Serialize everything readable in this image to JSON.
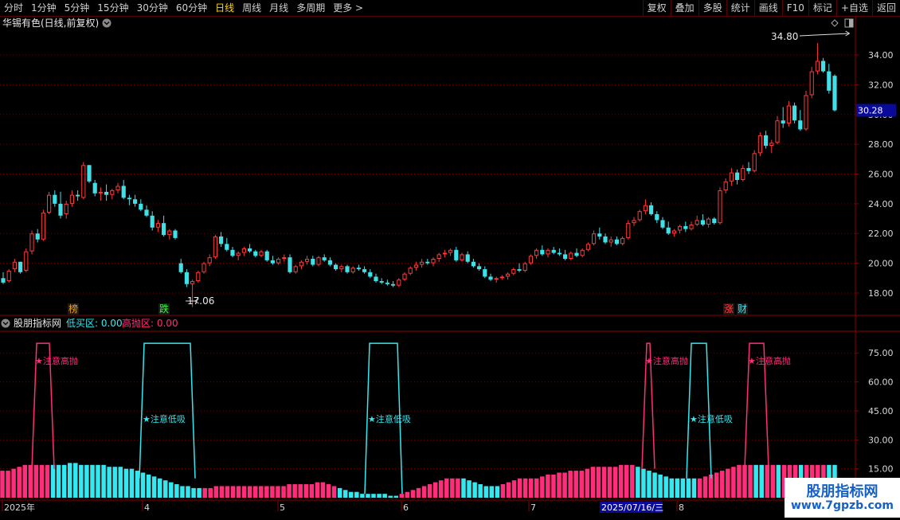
{
  "toolbar": {
    "periods": [
      "分时",
      "1分钟",
      "5分钟",
      "15分钟",
      "30分钟",
      "60分钟",
      "日线",
      "周线",
      "月线",
      "多周期",
      "更多 >"
    ],
    "active_period": "日线",
    "actions": [
      "复权",
      "叠加",
      "多股",
      "统计",
      "画线",
      "F10",
      "标记",
      "+自选",
      "返回"
    ]
  },
  "main_chart": {
    "title": "华锡有色(日线,前复权)",
    "high_label": "34.80",
    "low_label": "17.06",
    "current_price": "30.28",
    "y_ticks": [
      "34.00",
      "32.00",
      "30.00",
      "28.00",
      "26.00",
      "24.00",
      "22.00",
      "20.00",
      "18.00"
    ],
    "markers": [
      "榜",
      "跌",
      "涨",
      "财"
    ]
  },
  "indicator": {
    "name": "股朋指标网",
    "low_label": "低买区: 0.00",
    "high_label": "高抛区: 0.00",
    "y_ticks": [
      "75.00",
      "60.00",
      "45.00",
      "30.00",
      "15.00"
    ],
    "annotations": [
      "★注意高抛",
      "★注意低吸",
      "★注意低吸",
      "★注意高抛",
      "★注意低吸",
      "★注意高抛"
    ]
  },
  "time_axis": {
    "labels": [
      "2025年",
      "4",
      "5",
      "6",
      "7",
      "2025/07/16/三",
      "8"
    ]
  },
  "watermark": {
    "site_name": "股朋指标网",
    "url": "www.7gpzb.com"
  },
  "colors": {
    "up": "#ff3a3a",
    "down": "#3fe0e8",
    "pink": "#ff2d7a",
    "cyan": "#33e8f0",
    "grid": "#6b0000",
    "axis_text": "#d8d8d8"
  },
  "chart_data": {
    "type": "candlestick",
    "y_range": [
      16.5,
      35.5
    ],
    "candles": [
      [
        19.0,
        19.4,
        18.6,
        18.7
      ],
      [
        18.8,
        19.6,
        18.7,
        19.5
      ],
      [
        19.6,
        20.3,
        19.4,
        20.1
      ],
      [
        20.1,
        20.1,
        19.3,
        19.4
      ],
      [
        19.5,
        21.0,
        19.4,
        20.8
      ],
      [
        20.8,
        22.2,
        20.6,
        22.0
      ],
      [
        22.0,
        22.3,
        21.4,
        21.6
      ],
      [
        21.6,
        23.6,
        21.5,
        23.4
      ],
      [
        23.4,
        24.8,
        23.3,
        24.6
      ],
      [
        24.6,
        24.9,
        23.8,
        24.0
      ],
      [
        24.0,
        24.8,
        23.0,
        23.2
      ],
      [
        23.3,
        24.2,
        23.0,
        24.0
      ],
      [
        24.0,
        24.9,
        23.8,
        24.6
      ],
      [
        24.6,
        24.9,
        24.2,
        24.5
      ],
      [
        24.4,
        26.8,
        24.3,
        26.6
      ],
      [
        26.6,
        26.6,
        25.4,
        25.5
      ],
      [
        25.4,
        25.6,
        24.5,
        24.7
      ],
      [
        24.7,
        25.1,
        24.2,
        24.8
      ],
      [
        24.8,
        25.3,
        24.2,
        24.6
      ],
      [
        24.6,
        25.0,
        24.3,
        24.9
      ],
      [
        24.9,
        25.4,
        24.7,
        25.2
      ],
      [
        25.2,
        25.6,
        24.3,
        24.4
      ],
      [
        24.4,
        24.6,
        23.9,
        24.3
      ],
      [
        24.3,
        24.6,
        23.8,
        24.0
      ],
      [
        24.0,
        24.3,
        23.5,
        23.6
      ],
      [
        23.6,
        23.9,
        23.1,
        23.2
      ],
      [
        23.2,
        23.5,
        22.2,
        22.4
      ],
      [
        22.4,
        22.9,
        22.1,
        22.7
      ],
      [
        22.7,
        23.2,
        21.8,
        21.9
      ],
      [
        21.9,
        22.3,
        21.6,
        22.2
      ],
      [
        22.2,
        22.3,
        21.6,
        21.7
      ],
      [
        20.0,
        20.3,
        19.3,
        19.4
      ],
      [
        19.4,
        19.6,
        18.4,
        18.6
      ],
      [
        18.6,
        18.9,
        17.06,
        18.8
      ],
      [
        18.8,
        19.5,
        18.7,
        19.4
      ],
      [
        19.4,
        20.1,
        19.3,
        20.0
      ],
      [
        20.0,
        20.6,
        19.8,
        20.4
      ],
      [
        20.4,
        21.9,
        20.3,
        21.8
      ],
      [
        21.8,
        22.1,
        21.1,
        21.3
      ],
      [
        21.3,
        21.7,
        20.8,
        20.9
      ],
      [
        20.9,
        21.1,
        20.4,
        20.5
      ],
      [
        20.5,
        20.8,
        20.2,
        20.7
      ],
      [
        20.7,
        21.1,
        20.5,
        21.0
      ],
      [
        21.0,
        21.3,
        20.7,
        20.8
      ],
      [
        20.8,
        20.9,
        20.4,
        20.5
      ],
      [
        20.5,
        20.9,
        20.4,
        20.8
      ],
      [
        20.8,
        20.9,
        20.1,
        20.2
      ],
      [
        20.2,
        20.5,
        19.9,
        20.0
      ],
      [
        20.0,
        20.4,
        19.9,
        20.3
      ],
      [
        20.3,
        20.6,
        20.1,
        20.4
      ],
      [
        20.4,
        20.6,
        19.3,
        19.4
      ],
      [
        19.4,
        19.9,
        19.3,
        19.8
      ],
      [
        19.8,
        20.2,
        19.6,
        20.1
      ],
      [
        20.1,
        20.5,
        19.9,
        20.3
      ],
      [
        20.3,
        20.5,
        19.8,
        19.9
      ],
      [
        19.9,
        20.5,
        19.8,
        20.4
      ],
      [
        20.4,
        20.6,
        20.1,
        20.2
      ],
      [
        20.2,
        20.4,
        19.8,
        19.9
      ],
      [
        19.9,
        20.0,
        19.5,
        19.6
      ],
      [
        19.6,
        19.9,
        19.4,
        19.8
      ],
      [
        19.8,
        19.9,
        19.3,
        19.4
      ],
      [
        19.4,
        19.8,
        19.3,
        19.7
      ],
      [
        19.7,
        19.9,
        19.5,
        19.6
      ],
      [
        19.6,
        19.8,
        19.3,
        19.4
      ],
      [
        19.4,
        19.6,
        19.0,
        19.1
      ],
      [
        19.1,
        19.3,
        18.7,
        18.8
      ],
      [
        18.8,
        19.0,
        18.6,
        18.7
      ],
      [
        18.7,
        18.9,
        18.5,
        18.6
      ],
      [
        18.6,
        18.8,
        18.4,
        18.5
      ],
      [
        18.5,
        19.0,
        18.4,
        18.9
      ],
      [
        18.9,
        19.4,
        18.8,
        19.3
      ],
      [
        19.3,
        19.8,
        19.2,
        19.7
      ],
      [
        19.7,
        20.1,
        19.5,
        19.9
      ],
      [
        19.9,
        20.3,
        19.7,
        20.1
      ],
      [
        20.1,
        20.3,
        19.9,
        20.0
      ],
      [
        20.0,
        20.4,
        19.8,
        20.3
      ],
      [
        20.3,
        20.7,
        20.1,
        20.6
      ],
      [
        20.6,
        20.9,
        20.4,
        20.7
      ],
      [
        20.7,
        21.0,
        20.5,
        20.9
      ],
      [
        20.9,
        21.1,
        20.1,
        20.2
      ],
      [
        20.2,
        20.7,
        20.1,
        20.6
      ],
      [
        20.6,
        20.8,
        20.0,
        20.1
      ],
      [
        20.1,
        20.3,
        19.7,
        19.8
      ],
      [
        19.8,
        20.0,
        19.5,
        19.6
      ],
      [
        19.6,
        19.8,
        19.0,
        19.1
      ],
      [
        19.1,
        19.3,
        18.8,
        18.9
      ],
      [
        18.9,
        19.1,
        18.7,
        19.0
      ],
      [
        19.0,
        19.2,
        18.9,
        19.1
      ],
      [
        19.1,
        19.4,
        18.9,
        19.3
      ],
      [
        19.3,
        19.7,
        19.2,
        19.6
      ],
      [
        19.6,
        20.0,
        19.4,
        19.5
      ],
      [
        19.5,
        20.1,
        19.4,
        20.0
      ],
      [
        20.0,
        20.6,
        19.9,
        20.5
      ],
      [
        20.5,
        21.0,
        20.3,
        20.9
      ],
      [
        20.9,
        21.2,
        20.5,
        20.6
      ],
      [
        20.6,
        21.0,
        20.4,
        20.9
      ],
      [
        20.9,
        21.1,
        20.6,
        20.7
      ],
      [
        20.7,
        21.0,
        20.5,
        20.6
      ],
      [
        20.6,
        20.9,
        20.2,
        20.3
      ],
      [
        20.3,
        20.8,
        20.2,
        20.7
      ],
      [
        20.7,
        21.0,
        20.4,
        20.5
      ],
      [
        20.5,
        21.0,
        20.4,
        20.9
      ],
      [
        20.9,
        21.4,
        20.8,
        21.3
      ],
      [
        21.3,
        22.2,
        21.2,
        22.0
      ],
      [
        22.0,
        22.4,
        21.6,
        21.8
      ],
      [
        21.8,
        22.0,
        21.3,
        21.4
      ],
      [
        21.4,
        21.8,
        21.1,
        21.6
      ],
      [
        21.6,
        21.8,
        21.2,
        21.3
      ],
      [
        21.3,
        21.8,
        21.2,
        21.7
      ],
      [
        21.7,
        22.9,
        21.6,
        22.7
      ],
      [
        22.7,
        23.1,
        22.5,
        22.9
      ],
      [
        22.9,
        23.6,
        22.8,
        23.5
      ],
      [
        23.5,
        24.3,
        23.3,
        23.9
      ],
      [
        23.9,
        24.1,
        23.2,
        23.3
      ],
      [
        23.3,
        23.5,
        22.7,
        22.9
      ],
      [
        22.9,
        23.1,
        22.3,
        22.4
      ],
      [
        22.4,
        22.8,
        21.9,
        22.0
      ],
      [
        22.0,
        22.3,
        21.8,
        22.2
      ],
      [
        22.2,
        22.6,
        22.0,
        22.5
      ],
      [
        22.5,
        22.8,
        22.1,
        22.3
      ],
      [
        22.3,
        22.8,
        22.2,
        22.6
      ],
      [
        22.6,
        23.2,
        22.5,
        22.9
      ],
      [
        22.9,
        23.3,
        22.5,
        22.6
      ],
      [
        22.6,
        23.1,
        22.4,
        23.0
      ],
      [
        23.0,
        23.1,
        22.6,
        22.7
      ],
      [
        22.7,
        25.1,
        22.6,
        24.9
      ],
      [
        24.9,
        25.7,
        24.7,
        25.5
      ],
      [
        25.5,
        26.4,
        25.2,
        26.1
      ],
      [
        26.1,
        26.3,
        25.3,
        25.6
      ],
      [
        25.6,
        26.6,
        25.5,
        26.4
      ],
      [
        26.4,
        26.8,
        26.0,
        26.2
      ],
      [
        26.2,
        27.6,
        26.1,
        27.4
      ],
      [
        27.4,
        28.8,
        27.2,
        28.6
      ],
      [
        28.6,
        28.9,
        27.7,
        27.9
      ],
      [
        27.9,
        28.3,
        27.4,
        28.1
      ],
      [
        28.1,
        29.9,
        28.0,
        29.6
      ],
      [
        29.6,
        30.5,
        29.1,
        29.4
      ],
      [
        29.4,
        30.9,
        29.2,
        30.6
      ],
      [
        30.6,
        30.8,
        29.4,
        29.6
      ],
      [
        29.6,
        30.3,
        28.9,
        29.0
      ],
      [
        29.0,
        31.6,
        28.9,
        31.3
      ],
      [
        31.3,
        33.2,
        31.1,
        32.9
      ],
      [
        32.9,
        34.8,
        32.7,
        33.6
      ],
      [
        33.6,
        33.8,
        32.8,
        32.9
      ],
      [
        32.9,
        33.4,
        31.4,
        31.6
      ],
      [
        32.6,
        32.7,
        30.2,
        30.28
      ]
    ],
    "indicator_bars": [
      [
        14,
        1
      ],
      [
        14,
        1
      ],
      [
        15,
        1
      ],
      [
        16,
        1
      ],
      [
        17,
        1
      ],
      [
        17,
        1
      ],
      [
        17,
        1
      ],
      [
        17,
        1
      ],
      [
        17,
        1
      ],
      [
        17,
        0
      ],
      [
        17,
        0
      ],
      [
        17,
        0
      ],
      [
        18,
        0
      ],
      [
        18,
        0
      ],
      [
        17,
        0
      ],
      [
        17,
        0
      ],
      [
        17,
        0
      ],
      [
        17,
        0
      ],
      [
        17,
        0
      ],
      [
        16,
        0
      ],
      [
        16,
        0
      ],
      [
        16,
        0
      ],
      [
        15,
        0
      ],
      [
        15,
        0
      ],
      [
        14,
        0
      ],
      [
        13,
        0
      ],
      [
        12,
        0
      ],
      [
        11,
        0
      ],
      [
        10,
        0
      ],
      [
        9,
        0
      ],
      [
        8,
        0
      ],
      [
        7,
        0
      ],
      [
        6,
        0
      ],
      [
        6,
        0
      ],
      [
        5,
        0
      ],
      [
        5,
        0
      ],
      [
        5,
        1
      ],
      [
        5,
        1
      ],
      [
        6,
        1
      ],
      [
        6,
        1
      ],
      [
        6,
        1
      ],
      [
        6,
        1
      ],
      [
        6,
        1
      ],
      [
        6,
        1
      ],
      [
        6,
        1
      ],
      [
        6,
        1
      ],
      [
        6,
        1
      ],
      [
        6,
        1
      ],
      [
        6,
        1
      ],
      [
        6,
        1
      ],
      [
        6,
        1
      ],
      [
        7,
        1
      ],
      [
        7,
        1
      ],
      [
        7,
        1
      ],
      [
        7,
        1
      ],
      [
        7,
        1
      ],
      [
        8,
        1
      ],
      [
        8,
        1
      ],
      [
        7,
        1
      ],
      [
        6,
        1
      ],
      [
        5,
        0
      ],
      [
        4,
        0
      ],
      [
        3,
        0
      ],
      [
        3,
        0
      ],
      [
        2,
        0
      ],
      [
        2,
        0
      ],
      [
        2,
        0
      ],
      [
        2,
        0
      ],
      [
        2,
        0
      ],
      [
        1,
        0
      ],
      [
        1,
        0
      ],
      [
        2,
        1
      ],
      [
        3,
        1
      ],
      [
        4,
        1
      ],
      [
        5,
        1
      ],
      [
        6,
        1
      ],
      [
        7,
        1
      ],
      [
        8,
        1
      ],
      [
        9,
        1
      ],
      [
        10,
        1
      ],
      [
        10,
        1
      ],
      [
        10,
        1
      ],
      [
        10,
        0
      ],
      [
        9,
        0
      ],
      [
        8,
        0
      ],
      [
        7,
        0
      ],
      [
        6,
        0
      ],
      [
        6,
        0
      ],
      [
        6,
        0
      ],
      [
        7,
        1
      ],
      [
        8,
        1
      ],
      [
        9,
        1
      ],
      [
        10,
        1
      ],
      [
        10,
        1
      ],
      [
        10,
        1
      ],
      [
        10,
        1
      ],
      [
        11,
        1
      ],
      [
        12,
        1
      ],
      [
        12,
        1
      ],
      [
        13,
        1
      ],
      [
        13,
        1
      ],
      [
        14,
        1
      ],
      [
        14,
        1
      ],
      [
        14,
        1
      ],
      [
        15,
        1
      ],
      [
        16,
        1
      ],
      [
        16,
        1
      ],
      [
        16,
        1
      ],
      [
        16,
        1
      ],
      [
        16,
        1
      ],
      [
        17,
        1
      ],
      [
        17,
        1
      ],
      [
        17,
        1
      ],
      [
        16,
        0
      ],
      [
        15,
        0
      ],
      [
        14,
        0
      ],
      [
        13,
        0
      ],
      [
        12,
        0
      ],
      [
        11,
        0
      ],
      [
        10,
        0
      ],
      [
        10,
        0
      ],
      [
        10,
        0
      ],
      [
        10,
        0
      ],
      [
        10,
        0
      ],
      [
        10,
        1
      ],
      [
        11,
        1
      ],
      [
        12,
        1
      ],
      [
        13,
        1
      ],
      [
        14,
        1
      ],
      [
        15,
        1
      ],
      [
        16,
        1
      ],
      [
        17,
        1
      ],
      [
        17,
        1
      ],
      [
        17,
        1
      ],
      [
        17,
        0
      ],
      [
        17,
        0
      ],
      [
        17,
        1
      ],
      [
        17,
        1
      ],
      [
        17,
        0
      ],
      [
        17,
        1
      ],
      [
        17,
        1
      ],
      [
        17,
        1
      ],
      [
        17,
        0
      ],
      [
        17,
        1
      ],
      [
        17,
        1
      ],
      [
        17,
        1
      ],
      [
        17,
        1
      ],
      [
        17,
        0
      ],
      [
        17,
        0
      ]
    ],
    "zones": [
      {
        "type": "high",
        "color": "pink",
        "x1": 40,
        "x2": 68,
        "top": 80,
        "base": 15
      },
      {
        "type": "low",
        "color": "cyan",
        "x1": 175,
        "x2": 245,
        "top": 80,
        "base": 10
      },
      {
        "type": "low",
        "color": "cyan",
        "x1": 458,
        "x2": 505,
        "top": 80,
        "base": 2
      },
      {
        "type": "high",
        "color": "pink",
        "x1": 806,
        "x2": 822,
        "top": 80,
        "base": 15
      },
      {
        "type": "low",
        "color": "cyan",
        "x1": 862,
        "x2": 893,
        "top": 80,
        "base": 10
      },
      {
        "type": "high",
        "color": "pink",
        "x1": 935,
        "x2": 965,
        "top": 80,
        "base": 15
      }
    ],
    "indicator_y_range": [
      0,
      85
    ]
  }
}
